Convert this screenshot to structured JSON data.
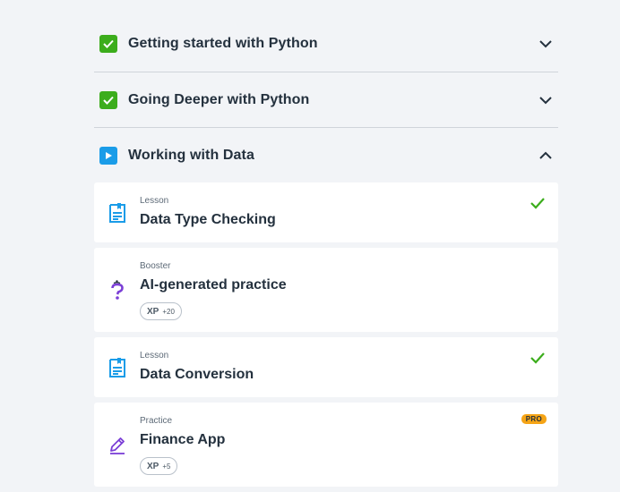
{
  "sections": [
    {
      "title": "Getting started with Python",
      "status": "completed",
      "expanded": false
    },
    {
      "title": "Going Deeper with Python",
      "status": "completed",
      "expanded": false
    },
    {
      "title": "Working with Data",
      "status": "in-progress",
      "expanded": true
    }
  ],
  "items": [
    {
      "type": "Lesson",
      "title": "Data Type Checking",
      "completed": true,
      "icon": "lesson-doc-icon"
    },
    {
      "type": "Booster",
      "title": "AI-generated practice",
      "xp_label": "XP",
      "xp_value": "+20",
      "icon": "ai-question-icon"
    },
    {
      "type": "Lesson",
      "title": "Data Conversion",
      "completed": true,
      "icon": "lesson-doc-icon"
    },
    {
      "type": "Practice",
      "title": "Finance App",
      "xp_label": "XP",
      "xp_value": "+5",
      "badge": "PRO",
      "icon": "practice-pencil-icon"
    }
  ],
  "colors": {
    "completed": "#3cad1c",
    "in_progress": "#1a9ce8",
    "lesson_icon": "#1a9ce8",
    "booster_icon": "#7b3fd6",
    "practice_icon": "#7b3fd6",
    "pro_badge": "#f5a416"
  }
}
